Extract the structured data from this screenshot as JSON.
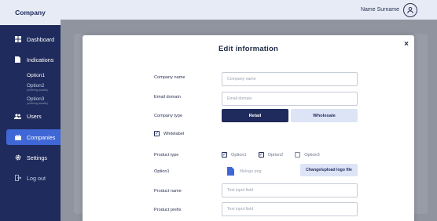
{
  "sidebar": {
    "company": "Company",
    "items": [
      {
        "label": "Dashboard",
        "icon": "grid-icon"
      },
      {
        "label": "Indications",
        "icon": "document-icon"
      },
      {
        "label": "Users",
        "icon": "users-icon"
      },
      {
        "label": "Companies",
        "icon": "briefcase-icon"
      },
      {
        "label": "Settings",
        "icon": "gear-icon"
      },
      {
        "label": "Log out",
        "icon": "logout-icon"
      }
    ],
    "sub": [
      {
        "label": "Option1"
      },
      {
        "label": "Option2",
        "note": "(ordering awaits)"
      },
      {
        "label": "Option3",
        "note": "(ordering awaits)"
      }
    ]
  },
  "topbar": {
    "user_name": "Name Surname"
  },
  "modal": {
    "title": "Edit  information",
    "close": "×",
    "company_name": {
      "label": "Company name",
      "placeholder": "Company name"
    },
    "email_domain": {
      "label": "Email domain",
      "placeholder": "Email domain"
    },
    "company_type": {
      "label": "Company type",
      "options": [
        "Retail",
        "Wholesale"
      ],
      "selected": "Retail"
    },
    "whitelabel": {
      "label": "Whitelabel",
      "checked": true
    },
    "product_type": {
      "label": "Product type",
      "options": [
        {
          "label": "Option1",
          "checked": true
        },
        {
          "label": "Option2",
          "checked": true
        },
        {
          "label": "Option3",
          "checked": false
        }
      ]
    },
    "option1": {
      "label": "Option1",
      "file_name": "filelogo.png",
      "upload_label": "Change/upload logo file"
    },
    "product_name": {
      "label": "Product name",
      "placeholder": "Text input field"
    },
    "product_prefix": {
      "label": "Product prefix",
      "placeholder": "Text input field"
    }
  },
  "colors": {
    "navy": "#1f2b5c",
    "accent": "#3f67d6",
    "light_blue": "#dde4f6"
  }
}
